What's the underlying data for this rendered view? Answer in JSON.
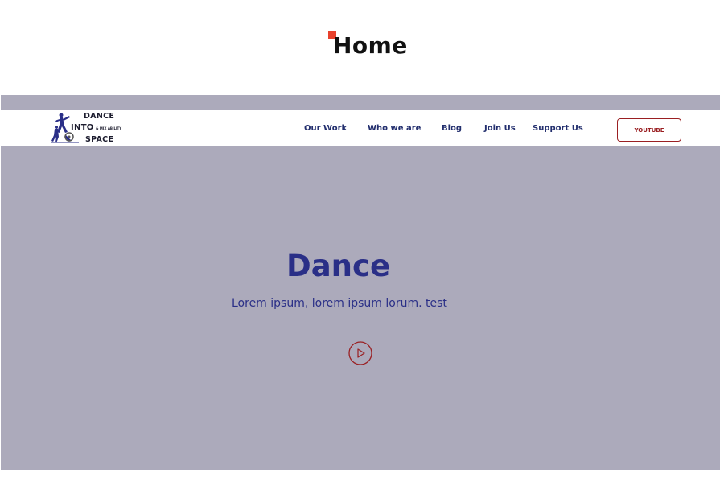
{
  "page": {
    "title": "Home"
  },
  "logo": {
    "line1": "DANCE",
    "line2": "INTO",
    "line2_small": "& MIX ABILITY",
    "line3": "SPACE"
  },
  "nav": {
    "items": [
      {
        "label": "Our Work"
      },
      {
        "label": "Who we are"
      },
      {
        "label": "Blog"
      },
      {
        "label": "Join Us"
      },
      {
        "label": "Support Us"
      }
    ],
    "cta_label": "YOUTUBE"
  },
  "hero": {
    "heading": "Dance",
    "subheading": "Lorem ipsum, lorem ipsum lorum. test",
    "play_icon": "play-circle-icon"
  },
  "colors": {
    "accent_red": "#9a1f22",
    "title_marker": "#e8412c",
    "navy": "#2a2f87",
    "hero_bg": "#acaabb"
  }
}
